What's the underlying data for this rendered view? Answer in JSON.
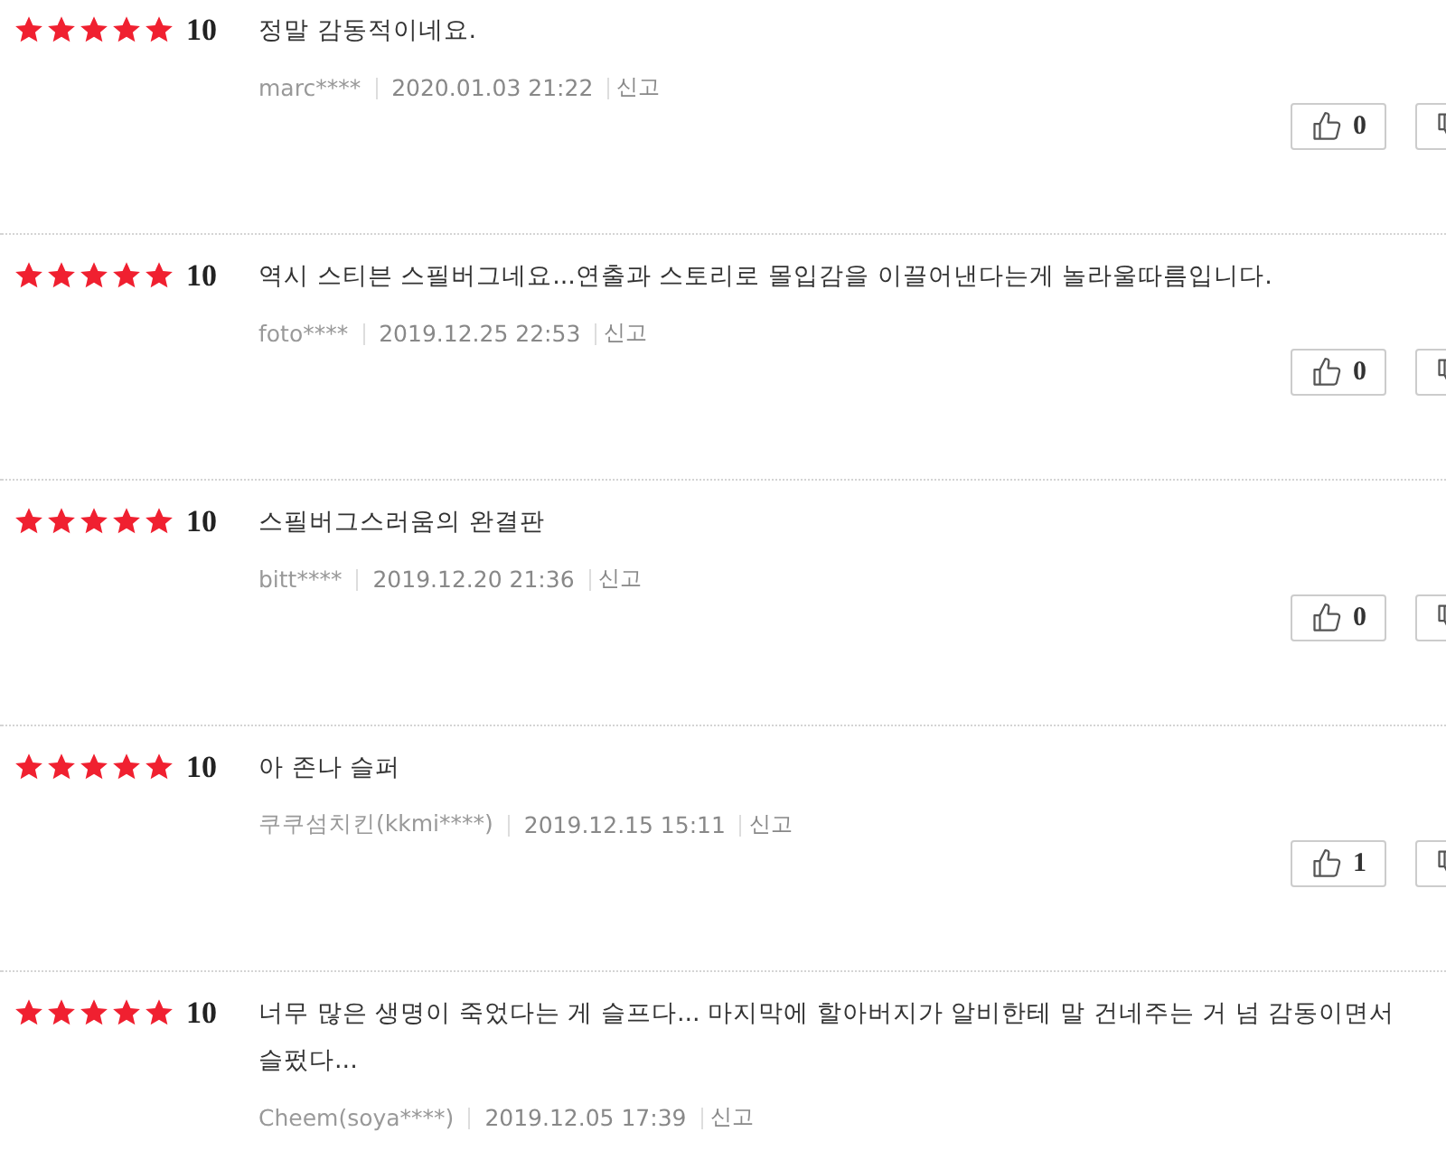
{
  "reviews": [
    {
      "stars": 5,
      "score": "10",
      "text": "정말 감동적이네요.",
      "author": "marc****",
      "date": "2020.01.03 21:22",
      "report": "신고",
      "likes": "0"
    },
    {
      "stars": 5,
      "score": "10",
      "text": "역시 스티븐 스필버그네요...연출과 스토리로 몰입감을 이끌어낸다는게 놀라울따름입니다.",
      "author": "foto****",
      "date": "2019.12.25 22:53",
      "report": "신고",
      "likes": "0"
    },
    {
      "stars": 5,
      "score": "10",
      "text": "스필버그스러움의 완결판",
      "author": "bitt****",
      "date": "2019.12.20 21:36",
      "report": "신고",
      "likes": "0"
    },
    {
      "stars": 5,
      "score": "10",
      "text": "아 존나 슬퍼",
      "author": "쿠쿠섬치킨(kkmi****)",
      "date": "2019.12.15 15:11",
      "report": "신고",
      "likes": "1"
    },
    {
      "stars": 5,
      "score": "10",
      "text": "너무 많은 생명이 죽었다는 게 슬프다... 마지막에 할아버지가 알비한테 말 건네주는 거 넘 감동이면서 슬펐다...",
      "author": "Cheem(soya****)",
      "date": "2019.12.05 17:39",
      "report": "신고"
    }
  ]
}
